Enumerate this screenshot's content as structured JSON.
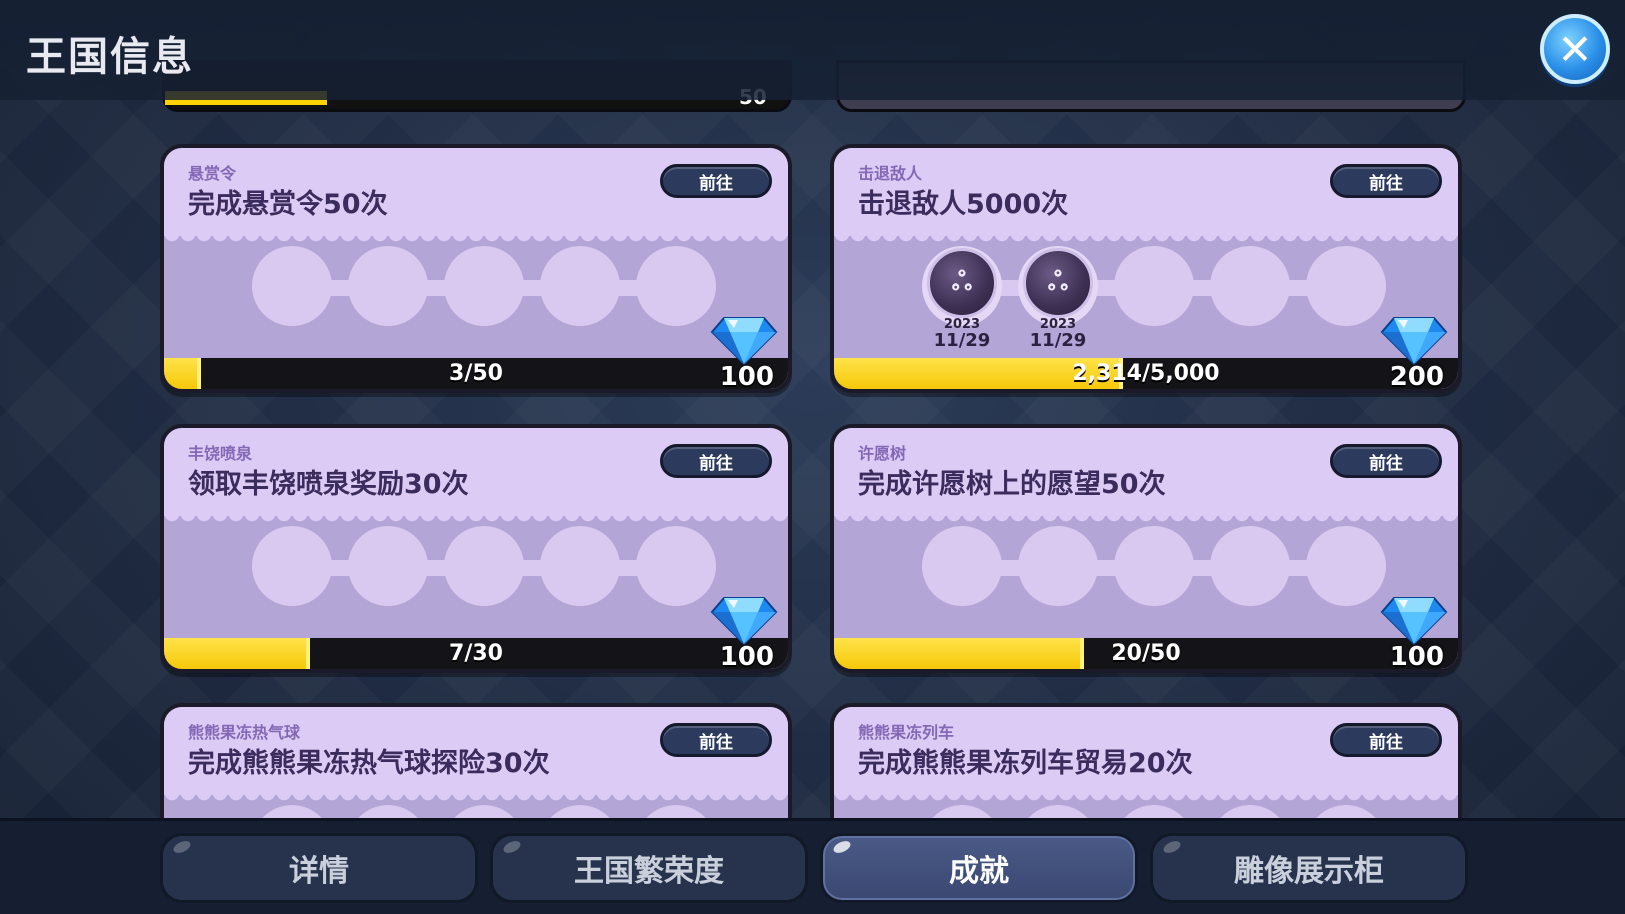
{
  "header": {
    "title": "王国信息",
    "close_icon": "close-x-icon"
  },
  "cards": [
    {
      "category": "悬赏令",
      "task": "完成悬赏令50次",
      "button": "前往",
      "progress_text": "3/50",
      "progress_fraction": 0.06,
      "reward_icon": "blue-diamond-icon",
      "reward": "100",
      "medals": []
    },
    {
      "category": "击退敌人",
      "task": "击退敌人5000次",
      "button": "前往",
      "progress_text": "2,314/5,000",
      "progress_fraction": 0.4628,
      "reward_icon": "blue-diamond-icon",
      "reward": "200",
      "medals": [
        {
          "year": "2023",
          "date": "11/29"
        },
        {
          "year": "2023",
          "date": "11/29"
        }
      ]
    },
    {
      "category": "丰饶喷泉",
      "task": "领取丰饶喷泉奖励30次",
      "button": "前往",
      "progress_text": "7/30",
      "progress_fraction": 0.2333,
      "reward_icon": "blue-diamond-icon",
      "reward": "100",
      "medals": []
    },
    {
      "category": "许愿树",
      "task": "完成许愿树上的愿望50次",
      "button": "前往",
      "progress_text": "20/50",
      "progress_fraction": 0.4,
      "reward_icon": "blue-diamond-icon",
      "reward": "100",
      "medals": []
    },
    {
      "category": "熊熊果冻热气球",
      "task": "完成熊熊果冻热气球探险30次",
      "button": "前往",
      "medals": []
    },
    {
      "category": "熊熊果冻列车",
      "task": "完成熊熊果冻列车贸易20次",
      "button": "前往",
      "medals": []
    }
  ],
  "partial_top": {
    "left_fragment_right": "50",
    "left_progress_fraction": 0.26
  },
  "tabs": [
    {
      "label": "详情",
      "active": false
    },
    {
      "label": "王国繁荣度",
      "active": false
    },
    {
      "label": "成就",
      "active": true
    },
    {
      "label": "雕像展示柜",
      "active": false
    }
  ],
  "colors": {
    "progress_fill": "#ffd200",
    "card_bg": "#b3a5d6",
    "card_head": "#dccbf4",
    "active_tab": "#3a4872"
  }
}
